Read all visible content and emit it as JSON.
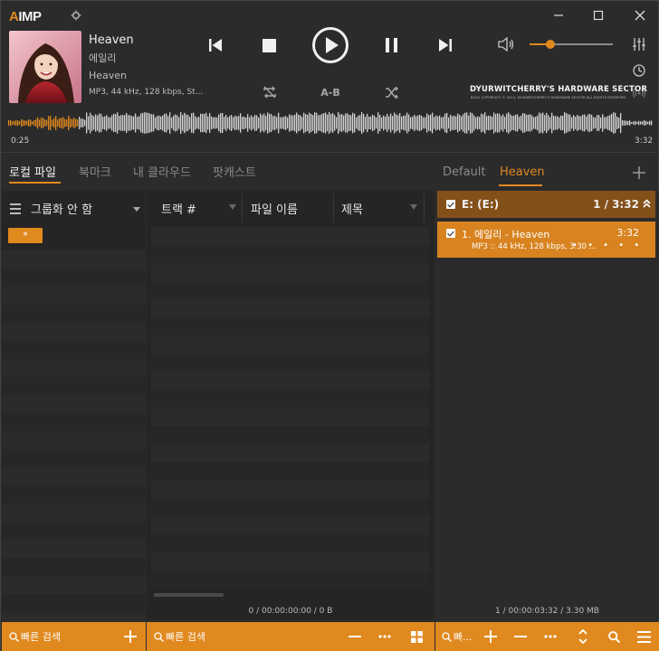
{
  "app": {
    "logo_a": "A",
    "logo_rest": "IMP"
  },
  "now_playing": {
    "title": "Heaven",
    "artist": "에일리",
    "album": "Heaven",
    "info": "MP3, 44 kHz, 128 kbps, St...",
    "elapsed": "0:25",
    "total": "3:32",
    "progress": 0.118
  },
  "controls": {
    "ab_label": "A-B"
  },
  "volume": {
    "level": 0.25
  },
  "banner": {
    "title": "DYURWITCHERRY'S HARDWARE SECTOR",
    "subtitle": "BLOG COPYRIGHT © 2013, DYURWITCHERRY'S HARDWARE SECTOR ALL RIGHTS RESERVED."
  },
  "left_tabs": [
    {
      "label": "로컬 파일",
      "active": true
    },
    {
      "label": "북마크",
      "active": false
    },
    {
      "label": "내 클라우드",
      "active": false
    },
    {
      "label": "팟캐스트",
      "active": false
    }
  ],
  "grouping": {
    "label": "그룹화 안 함",
    "filter_chip": "*"
  },
  "columns": [
    {
      "label": "트랙 #"
    },
    {
      "label": "파일 이름"
    },
    {
      "label": "제목"
    }
  ],
  "mid_status": "0 / 00:00:00:00 / 0 B",
  "playlists": {
    "tabs": [
      {
        "label": "Default",
        "active": false
      },
      {
        "label": "Heaven",
        "active": true
      }
    ],
    "group": {
      "name": "E: (E:)",
      "count": "1 / 3:32"
    },
    "items": [
      {
        "title": "1. 에일리 - Heaven",
        "duration": "3:32",
        "meta": "MP3 :: 44 kHz, 128 kbps, 3.30 ...",
        "rating_dots": "• • • • •"
      }
    ],
    "status": "1 / 00:00:03:32 / 3.30 MB"
  },
  "bottom": {
    "left_search_placeholder": "빠른 검색",
    "mid_search_placeholder": "빠른 검색",
    "right_search_placeholder": "빠..."
  },
  "colors": {
    "accent": "#e0891f",
    "group_header": "#84501a",
    "background": "#2b2b2b"
  }
}
